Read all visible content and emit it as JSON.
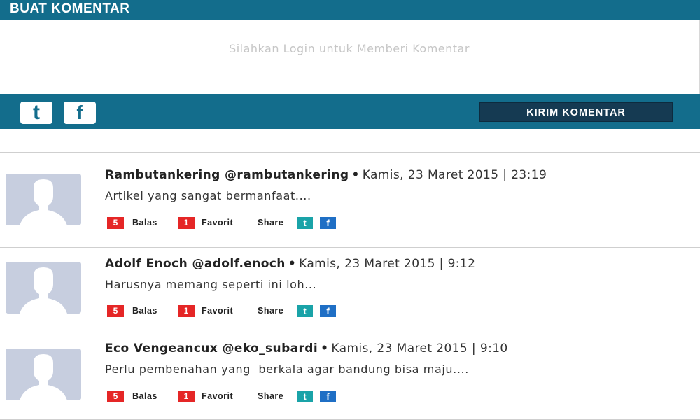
{
  "header": {
    "title": "BUAT KOMENTAR"
  },
  "login_prompt": "Silahkan Login untuk Memberi Komentar",
  "share_bar": {
    "icons": [
      "twitter-icon",
      "facebook-icon"
    ],
    "twitter_glyph": "t",
    "facebook_glyph": "f",
    "submit_label": "KIRIM KOMENTAR"
  },
  "colors": {
    "header_bg": "#136d8c",
    "submit_bg": "#153a52",
    "count_badge": "#e52626",
    "twitter": "#1aa3a8",
    "facebook": "#1f6fc5"
  },
  "comments": [
    {
      "author": "Rambutankering @rambutankering",
      "separator": "•",
      "date": "Kamis, 23 Maret 2015 | 23:19",
      "text": "Artikel yang sangat bermanfaat....",
      "reply_count": "5",
      "reply_label": "Balas",
      "fav_count": "1",
      "fav_label": "Favorit",
      "share_label": "Share",
      "tw": "t",
      "fb": "f"
    },
    {
      "author": "Adolf Enoch @adolf.enoch",
      "separator": "•",
      "date": "Kamis, 23 Maret 2015 | 9:12",
      "text": "Harusnya memang seperti ini loh...",
      "reply_count": "5",
      "reply_label": "Balas",
      "fav_count": "1",
      "fav_label": "Favorit",
      "share_label": "Share",
      "tw": "t",
      "fb": "f"
    },
    {
      "author": "Eco Vengeancux @eko_subardi",
      "separator": "•",
      "date": "Kamis, 23 Maret 2015 | 9:10",
      "text": "Perlu pembenahan yang  berkala agar bandung bisa maju....",
      "reply_count": "5",
      "reply_label": "Balas",
      "fav_count": "1",
      "fav_label": "Favorit",
      "share_label": "Share",
      "tw": "t",
      "fb": "f"
    }
  ]
}
